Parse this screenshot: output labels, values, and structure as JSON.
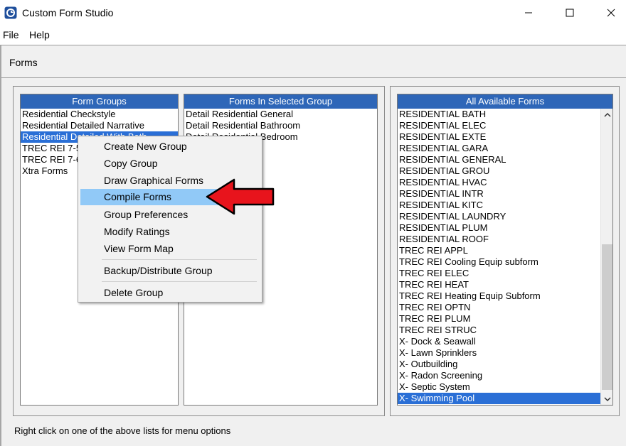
{
  "window": {
    "title": "Custom Form Studio",
    "controls": {
      "minimize": "minimize",
      "maximize": "maximize",
      "close": "close"
    }
  },
  "menu": {
    "items": [
      {
        "label": "File"
      },
      {
        "label": "Help"
      }
    ]
  },
  "panel": {
    "title": "Forms"
  },
  "form_groups": {
    "header": "Form Groups",
    "items": [
      {
        "label": "Residential Checkstyle",
        "selected": false
      },
      {
        "label": "Residential Detailed Narrative",
        "selected": false
      },
      {
        "label": "Residential Detailed With Bath",
        "selected": true
      },
      {
        "label": "TREC REI 7-5",
        "selected": false
      },
      {
        "label": "TREC REI 7-6",
        "selected": false
      },
      {
        "label": "Xtra Forms",
        "selected": false
      }
    ]
  },
  "forms_in_group": {
    "header": "Forms In Selected Group",
    "items": [
      {
        "label": "Detail Residential General"
      },
      {
        "label": "Detail Residential Bathroom"
      },
      {
        "label": "Detail Residential Bedroom"
      }
    ]
  },
  "all_forms": {
    "header": "All Available Forms",
    "items": [
      {
        "label": "RESIDENTIAL BATH",
        "selected": false
      },
      {
        "label": "RESIDENTIAL ELEC",
        "selected": false
      },
      {
        "label": "RESIDENTIAL EXTE",
        "selected": false
      },
      {
        "label": "RESIDENTIAL GARA",
        "selected": false
      },
      {
        "label": "RESIDENTIAL GENERAL",
        "selected": false
      },
      {
        "label": "RESIDENTIAL GROU",
        "selected": false
      },
      {
        "label": "RESIDENTIAL HVAC",
        "selected": false
      },
      {
        "label": "RESIDENTIAL INTR",
        "selected": false
      },
      {
        "label": "RESIDENTIAL KITC",
        "selected": false
      },
      {
        "label": "RESIDENTIAL LAUNDRY",
        "selected": false
      },
      {
        "label": "RESIDENTIAL PLUM",
        "selected": false
      },
      {
        "label": "RESIDENTIAL ROOF",
        "selected": false
      },
      {
        "label": "TREC REI APPL",
        "selected": false
      },
      {
        "label": "TREC REI Cooling Equip subform",
        "selected": false
      },
      {
        "label": "TREC REI ELEC",
        "selected": false
      },
      {
        "label": "TREC REI HEAT",
        "selected": false
      },
      {
        "label": "TREC REI Heating Equip Subform",
        "selected": false
      },
      {
        "label": "TREC REI OPTN",
        "selected": false
      },
      {
        "label": "TREC REI PLUM",
        "selected": false
      },
      {
        "label": "TREC REI STRUC",
        "selected": false
      },
      {
        "label": "X- Dock & Seawall",
        "selected": false
      },
      {
        "label": "X- Lawn Sprinklers",
        "selected": false
      },
      {
        "label": "X- Outbuilding",
        "selected": false
      },
      {
        "label": "X- Radon Screening",
        "selected": false
      },
      {
        "label": "X- Septic System",
        "selected": false
      },
      {
        "label": "X- Swimming Pool",
        "selected": true
      }
    ],
    "scroll_position": 0.9
  },
  "context_menu": {
    "items": [
      {
        "label": "Create New Group",
        "highlighted": false
      },
      {
        "label": "Copy Group",
        "highlighted": false
      },
      {
        "label": "Draw Graphical Forms",
        "highlighted": false
      },
      {
        "label": "Compile Forms",
        "highlighted": true
      },
      {
        "label": "Group Preferences",
        "highlighted": false
      },
      {
        "label": "Modify Ratings",
        "highlighted": false
      },
      {
        "label": "View Form Map",
        "highlighted": false
      },
      {
        "label": "Backup/Distribute Group",
        "highlighted": false
      },
      {
        "label": "Delete Group",
        "highlighted": false
      }
    ]
  },
  "status": {
    "text": "Right click on one of the above lists for menu options"
  },
  "colors": {
    "list_header": "#2e66b8",
    "selection": "#2a6fd6",
    "menu_highlight": "#91c9f7",
    "arrow": "#e8141c"
  }
}
